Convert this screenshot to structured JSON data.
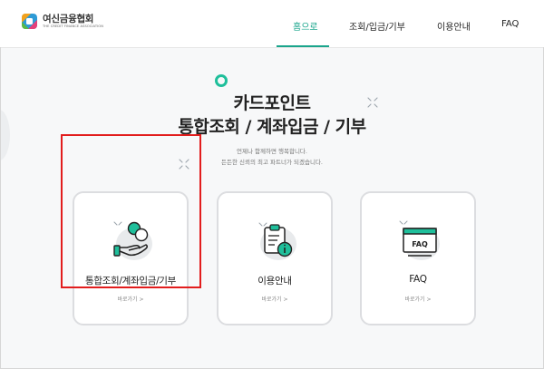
{
  "header": {
    "logo_title": "여신금융협회",
    "logo_subtitle": "THE CREDIT FINANCE ASSOCIATION",
    "nav": [
      {
        "label": "홈으로",
        "active": true
      },
      {
        "label": "조회/입금/기부",
        "active": false
      },
      {
        "label": "이용안내",
        "active": false
      },
      {
        "label": "FAQ",
        "active": false
      }
    ]
  },
  "hero": {
    "title_line1": "카드포인트",
    "title_line2": "통합조회 / 계좌입금 / 기부",
    "subtitle_line1": "언제나 함께하면 행복합니다.",
    "subtitle_line2": "든든한 신뢰의 최고 파트너가 되겠습니다."
  },
  "cards": [
    {
      "label": "통합조회/계좌입금/기부",
      "link": "바로가기 >",
      "icon": "coin-hand-icon"
    },
    {
      "label": "이용안내",
      "link": "바로가기 >",
      "icon": "clipboard-info-icon"
    },
    {
      "label": "FAQ",
      "link": "바로가기 >",
      "icon": "faq-window-icon"
    }
  ],
  "colors": {
    "accent": "#1aa58c",
    "highlight": "#e21d1d"
  }
}
